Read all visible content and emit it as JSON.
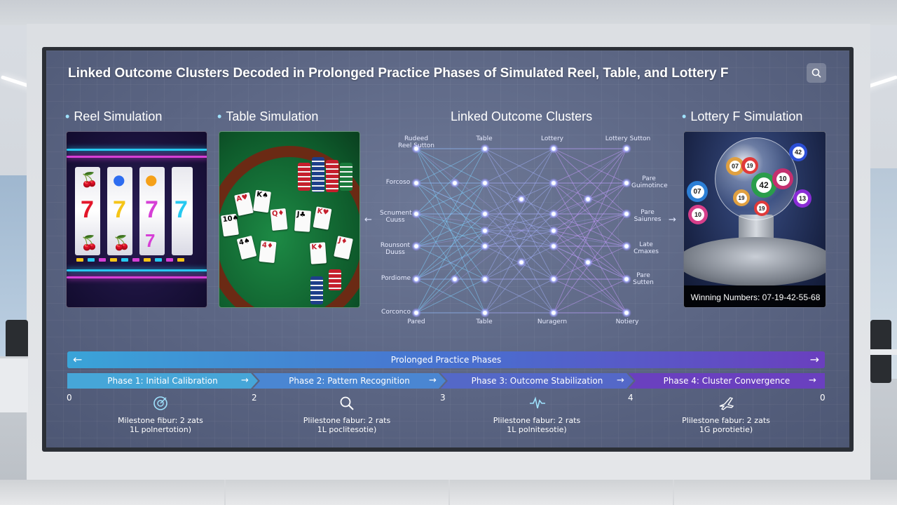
{
  "title": "Linked Outcome Clusters Decoded in Prolonged Practice Phases of Simulated Reel, Table, and Lottery F",
  "search_icon": "search-icon",
  "sections": {
    "reel": "Reel Simulation",
    "table": "Table Simulation",
    "clusters": "Linked Outcome Clusters",
    "lottery": "Lottery F Simulation"
  },
  "reel_panel": {
    "symbols": [
      "7",
      "7",
      "7",
      "7"
    ],
    "colors": {
      "red": "#e3162a",
      "yellow": "#f5c518",
      "magenta": "#d63fd6",
      "cyan": "#27c9f0"
    }
  },
  "cluster_diagram": {
    "column_headers": [
      "Reel Sutton",
      "Table",
      "Lottery",
      "Lottery Sutton"
    ],
    "left_labels": [
      "Forcoso",
      "Scnument Cuuss",
      "Rounsont Duuss",
      "Pordiome",
      "Corconco"
    ],
    "right_labels": [
      "Pare Guimotince",
      "Pare Saiunres",
      "Late Cmaxes",
      "Pare Sutten"
    ],
    "footer_labels": [
      "Pared",
      "Table",
      "Nuragern",
      "Notiery"
    ],
    "arrow_left": "←",
    "arrow_right": "→"
  },
  "lottery_panel": {
    "balls": [
      "07",
      "19",
      "42",
      "42",
      "10",
      "07",
      "19",
      "13",
      "10",
      "19"
    ],
    "winning_numbers": "Winning Numbers: 07-19-42-55-68"
  },
  "progress_bar": {
    "label": "Prolonged Practice Phases",
    "left_arrow": "←",
    "right_arrow": "→"
  },
  "phases": [
    {
      "label": "Phase 1: Initial Calibration",
      "arrow": "→"
    },
    {
      "label": "Phase 2: Pattern Recognition",
      "arrow": "→"
    },
    {
      "label": "Phase 3: Outcome Stabilization",
      "arrow": "→"
    },
    {
      "label": "Phase 4: Cluster Convergence",
      "arrow": "→"
    }
  ],
  "ticks": [
    "0",
    "2",
    "3",
    "4",
    "0"
  ],
  "milestones": [
    {
      "icon": "target-icon",
      "line1": "Milestone fibur: 2 zats",
      "line2": "1L polnertotion)"
    },
    {
      "icon": "search-icon",
      "line1": "Plilestone fabur: 2 rats",
      "line2": "1L poclitesotie)"
    },
    {
      "icon": "waveform-icon",
      "line1": "Plilestone fabur: 2 rats",
      "line2": "1L polnitesotie)"
    },
    {
      "icon": "airplane-icon",
      "line1": "Plilestone fabur: 2 zats",
      "line2": "1G porotietie)"
    }
  ]
}
